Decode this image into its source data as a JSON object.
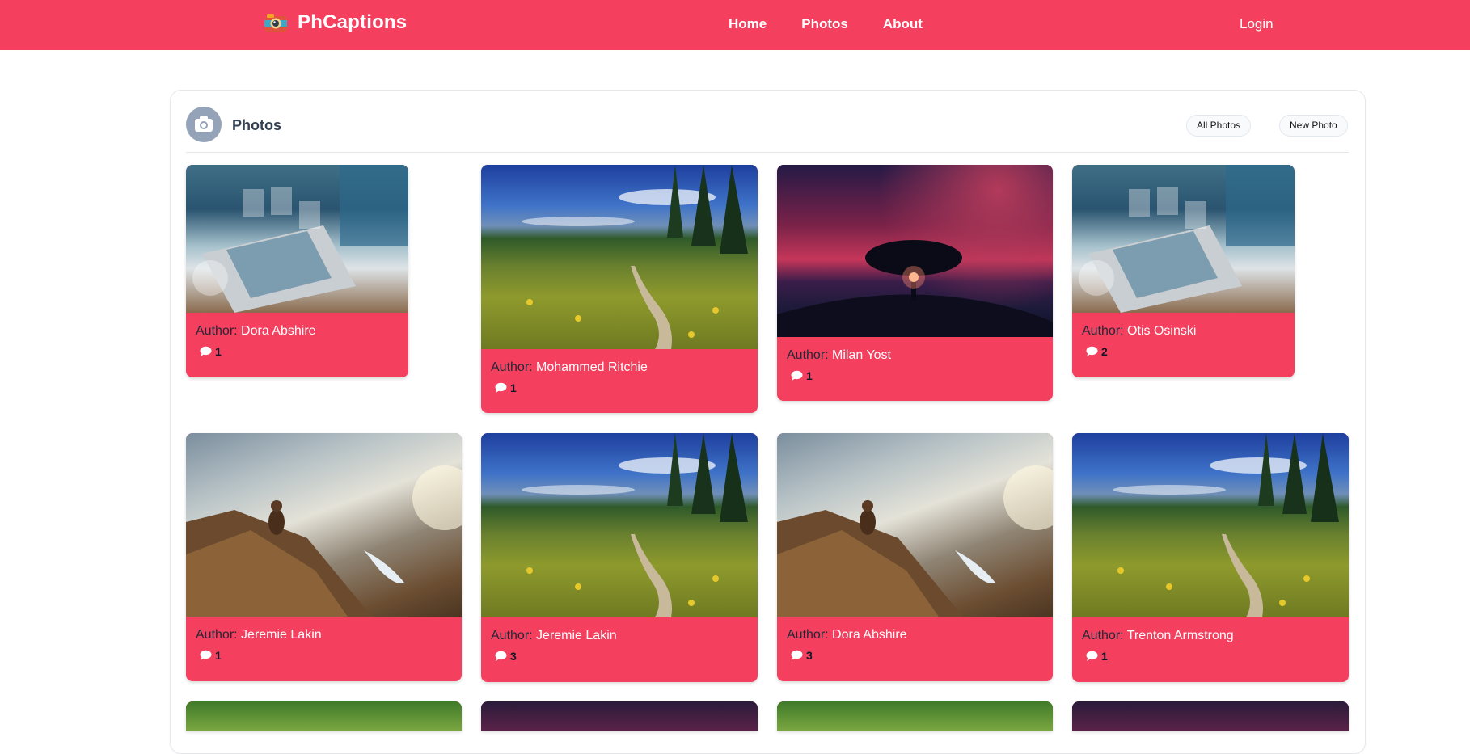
{
  "nav": {
    "brand": "PhCaptions",
    "links": [
      "Home",
      "Photos",
      "About"
    ],
    "login": "Login"
  },
  "section": {
    "title": "Photos",
    "all_photos": "All Photos",
    "new_photo": "New Photo"
  },
  "author_label": "Author:",
  "cards": [
    {
      "author": "Dora Abshire",
      "comments": "1",
      "photo": "laptop"
    },
    {
      "author": "Mohammed Ritchie",
      "comments": "1",
      "photo": "meadow"
    },
    {
      "author": "Milan Yost",
      "comments": "1",
      "photo": "sunset"
    },
    {
      "author": "Otis Osinski",
      "comments": "2",
      "photo": "laptop"
    },
    {
      "author": "Jeremie Lakin",
      "comments": "1",
      "photo": "hiker"
    },
    {
      "author": "Jeremie Lakin",
      "comments": "3",
      "photo": "meadow"
    },
    {
      "author": "Dora Abshire",
      "comments": "3",
      "photo": "hiker"
    },
    {
      "author": "Trenton Armstrong",
      "comments": "1",
      "photo": "meadow"
    }
  ],
  "colors": {
    "brand": "#f43f5e",
    "panel_icon": "#94a3b8"
  },
  "icons": [
    "camera-logo-icon",
    "camera-icon",
    "comment-icon"
  ]
}
